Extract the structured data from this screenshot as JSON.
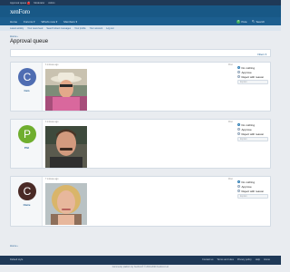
{
  "admin_bar": {
    "items": [
      "Approval queue",
      "Moderator",
      "Admin"
    ],
    "badge": "3"
  },
  "header": {
    "logo_main": "xenForo",
    "logo_accent": ""
  },
  "nav": {
    "tabs": [
      "Home",
      "Forums",
      "What's new",
      "Members"
    ],
    "user_initial": "P",
    "user_label": "Pete",
    "search_label": "Search"
  },
  "subnav": {
    "items": [
      "Latest activity",
      "Your news feed",
      "Search direct messages",
      "Your profile",
      "Your account",
      "Log out"
    ]
  },
  "breadcrumb": "Home ›",
  "page_title": "Approval queue",
  "filters_label": "Filters ▾",
  "queue": [
    {
      "initial": "C",
      "color": "#4f6db2",
      "username": "Cam",
      "posted": "3 minutes ago",
      "type": "Post",
      "options": [
        "Do nothing",
        "Approve",
        "Reject with reason"
      ],
      "explain_placeholder": "Explain"
    },
    {
      "initial": "P",
      "color": "#6fae2e",
      "username": "Phil",
      "posted": "3 minutes ago",
      "type": "Post",
      "options": [
        "Do nothing",
        "Approve",
        "Reject with reason"
      ],
      "explain_placeholder": "Explain"
    },
    {
      "initial": "C",
      "color": "#4a2a26",
      "username": "Claire",
      "posted": "7 minutes ago",
      "type": "Post",
      "options": [
        "Do nothing",
        "Approve",
        "Reject with reason"
      ],
      "explain_placeholder": "Explain"
    }
  ],
  "bottom_breadcrumb": "Home ›",
  "footer": {
    "left": "Default style",
    "links": [
      "Contact us",
      "Terms and rules",
      "Privacy policy",
      "Help",
      "Home"
    ]
  },
  "copyright": "Community platform by XenForo® © 2010-2020 XenForo Ltd."
}
